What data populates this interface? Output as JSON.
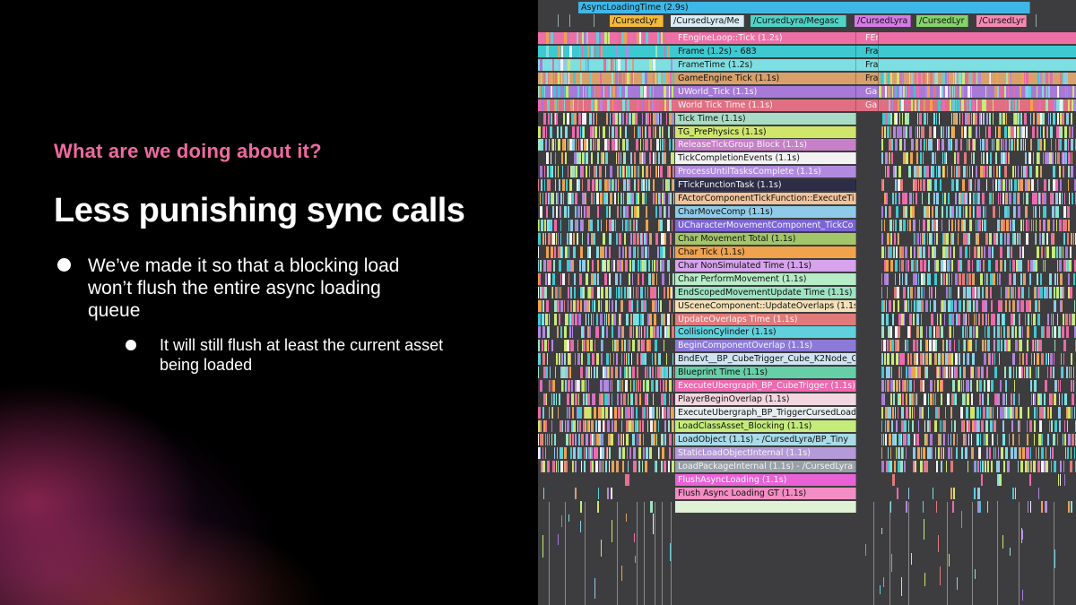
{
  "slide": {
    "subtitle": "What are we doing about it?",
    "title": "Less punishing sync calls",
    "bullet_1": "We’ve made it so that a blocking load won’t flush the entire async loading queue",
    "bullet_2": "It will still flush at least the current asset being loaded"
  },
  "timeline": {
    "top_track": {
      "label": "AsyncLoadingTime (2.9s)",
      "color": "#3fb7e6"
    },
    "second_row": [
      {
        "label": "/CursedLyr",
        "color": "#f2b93b"
      },
      {
        "label": "/CursedLyra/Me",
        "color": "#d9edf5"
      },
      {
        "label": "/CursedLyra/Megasc",
        "color": "#4fd3c5"
      },
      {
        "label": "/CursedLyra",
        "color": "#d47be6"
      },
      {
        "label": "/CursedLyr",
        "color": "#84d36b"
      },
      {
        "label": "/CursedLyr",
        "color": "#f58ab0"
      }
    ],
    "rows": [
      {
        "label": "FEngineLoop::Tick (1.2s)",
        "side": "FEn",
        "color": "#ee6fa6",
        "text": "light"
      },
      {
        "label": "Frame (1.2s) - 683",
        "side": "Fra",
        "color": "#3ec8d0",
        "text": "dark"
      },
      {
        "label": "FrameTime (1.2s)",
        "side": "Fra",
        "color": "#7edfe3",
        "text": "dark"
      },
      {
        "label": "GameEngine Tick (1.1s)",
        "side": "Fra",
        "color": "#d9a06a",
        "text": "dark"
      },
      {
        "label": "UWorld_Tick (1.1s)",
        "side": "Ga",
        "color": "#a77ad8",
        "text": "light"
      },
      {
        "label": "World Tick Time (1.1s)",
        "side": "Ga",
        "color": "#e06f82",
        "text": "light"
      },
      {
        "label": "Tick Time (1.1s)",
        "side": "",
        "color": "#a8dcc6",
        "text": "dark"
      },
      {
        "label": "TG_PrePhysics (1.1s)",
        "side": "",
        "color": "#cfe66a",
        "text": "dark"
      },
      {
        "label": "ReleaseTickGroup Block (1.1s)",
        "side": "",
        "color": "#c77fc8",
        "text": "light"
      },
      {
        "label": "TickCompletionEvents (1.1s)",
        "side": "",
        "color": "#f2f2f2",
        "text": "dark"
      },
      {
        "label": "ProcessUntilTasksComplete (1.1s)",
        "side": "",
        "color": "#b18ae0",
        "text": "light"
      },
      {
        "label": "FTickFunctionTask (1.1s)",
        "side": "",
        "color": "#2d2d48",
        "text": "light"
      },
      {
        "label": "FActorComponentTickFunction::ExecuteTi",
        "side": "",
        "color": "#f0c39a",
        "text": "dark"
      },
      {
        "label": "CharMoveComp (1.1s)",
        "side": "",
        "color": "#8fcbe8",
        "text": "dark"
      },
      {
        "label": "UCharacterMovementComponent_TickCo",
        "side": "",
        "color": "#7b64d6",
        "text": "light"
      },
      {
        "label": "Char Movement Total (1.1s)",
        "side": "",
        "color": "#a3c66b",
        "text": "dark"
      },
      {
        "label": "Char Tick (1.1s)",
        "side": "",
        "color": "#f0a24c",
        "text": "dark"
      },
      {
        "label": "Char NonSimulated Time (1.1s)",
        "side": "",
        "color": "#d6a3ec",
        "text": "dark"
      },
      {
        "label": "Char PerformMovement (1.1s)",
        "side": "",
        "color": "#b6ecc6",
        "text": "dark"
      },
      {
        "label": "EndScopedMovementUpdate Time (1.1s)",
        "side": "",
        "color": "#9ce3c2",
        "text": "dark"
      },
      {
        "label": "USceneComponent::UpdateOverlaps (1.1s",
        "side": "",
        "color": "#f4e1b8",
        "text": "dark"
      },
      {
        "label": "UpdateOverlaps Time (1.1s)",
        "side": "",
        "color": "#e07a7a",
        "text": "light"
      },
      {
        "label": "CollisionCylinder (1.1s)",
        "side": "",
        "color": "#5fd0dc",
        "text": "dark"
      },
      {
        "label": "BeginComponentOverlap (1.1s)",
        "side": "",
        "color": "#8c7ad8",
        "text": "light"
      },
      {
        "label": "BndEvt__BP_CubeTrigger_Cube_K2Node_C",
        "side": "",
        "color": "#cfe4f2",
        "text": "dark"
      },
      {
        "label": "Blueprint Time (1.1s)",
        "side": "",
        "color": "#66cfa8",
        "text": "dark"
      },
      {
        "label": "ExecuteUbergraph_BP_CubeTrigger (1.1s)",
        "side": "",
        "color": "#ee6ab0",
        "text": "light"
      },
      {
        "label": "PlayerBeginOverlap (1.1s)",
        "side": "",
        "color": "#f2d6e0",
        "text": "dark"
      },
      {
        "label": "ExecuteUbergraph_BP_TriggerCursedLoad",
        "side": "",
        "color": "#e8eef0",
        "text": "dark"
      },
      {
        "label": "LoadClassAsset_Blocking (1.1s)",
        "side": "",
        "color": "#c5ec7a",
        "text": "dark"
      },
      {
        "label": "LoadObject (1.1s) - /CursedLyra/BP_Tiny",
        "side": "",
        "color": "#a9dbe8",
        "text": "dark"
      },
      {
        "label": "StaticLoadObjectInternal (1.1s)",
        "side": "",
        "color": "#b49ad8",
        "text": "light"
      },
      {
        "label": "LoadPackageInternal (1.1s) - /CursedLyra",
        "side": "",
        "color": "#98a0a8",
        "text": "light"
      },
      {
        "label": "FlushAsyncLoading (1.1s)",
        "side": "",
        "color": "#e862d6",
        "text": "light"
      },
      {
        "label": "Flush Async Loading GT (1.1s)",
        "side": "",
        "color": "#f28ec3",
        "text": "dark"
      },
      {
        "label": "",
        "side": "",
        "color": "#dff2d6",
        "text": "dark"
      }
    ],
    "noise_palette": [
      "#e86aa5",
      "#3ec8d0",
      "#7edfe3",
      "#d9a06a",
      "#a77ad8",
      "#f0a24c",
      "#c5ec7a",
      "#b18ae0",
      "#9ce3c2",
      "#e07a7a",
      "#5fd0dc",
      "#f2f2f2",
      "#cfe66a",
      "#8fcbe8",
      "#ee6ab0"
    ]
  }
}
